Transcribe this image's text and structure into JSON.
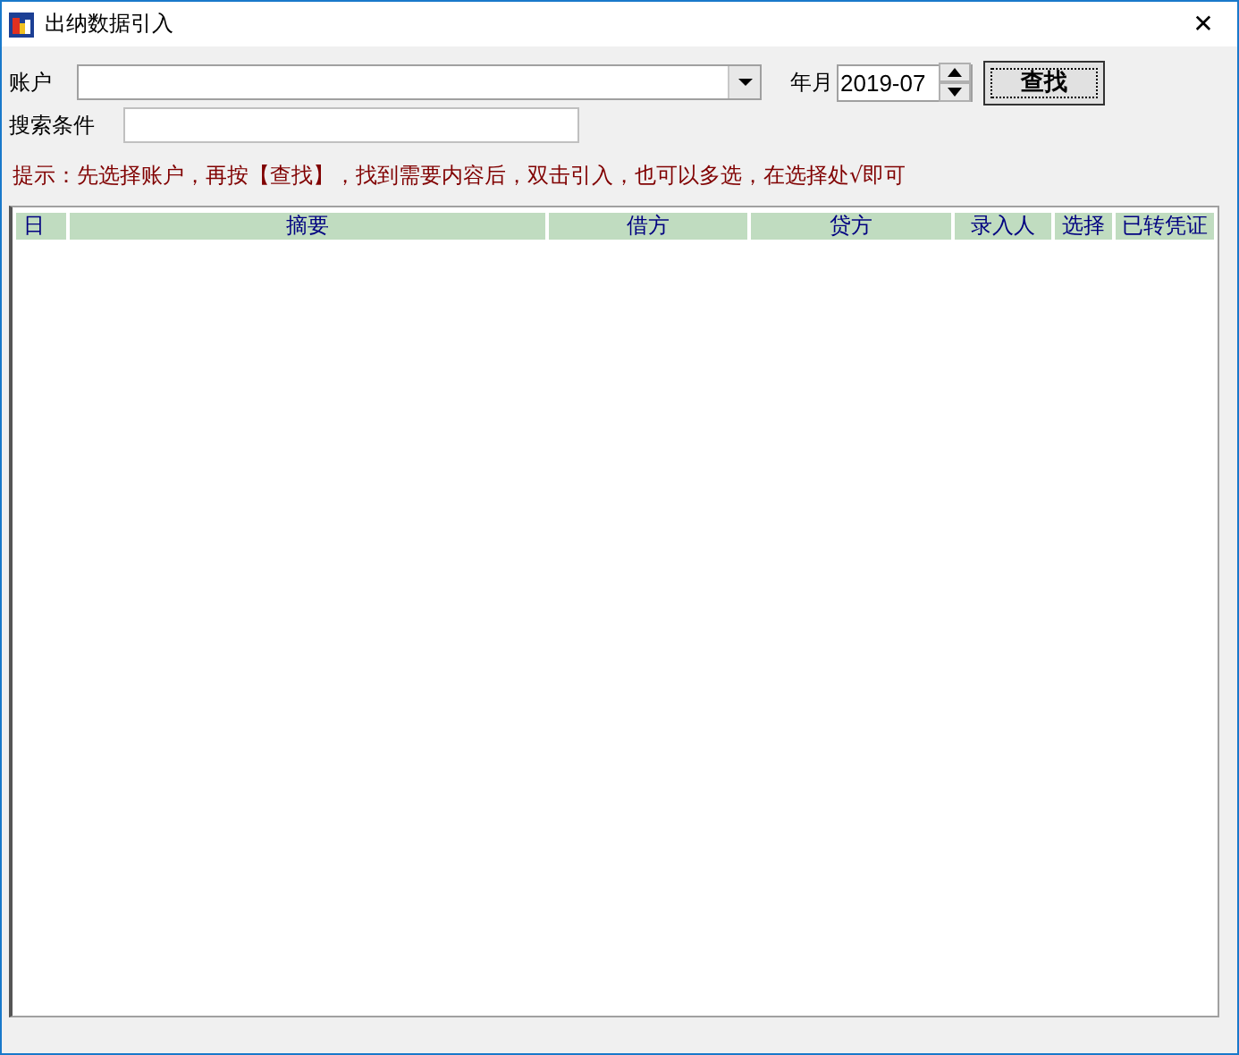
{
  "window": {
    "title": "出纳数据引入",
    "close": "✕"
  },
  "account": {
    "label": "账户"
  },
  "period": {
    "label": "年月",
    "value": "2019-07"
  },
  "find_button": "查找",
  "search": {
    "label": "搜索条件"
  },
  "hint": "提示：先选择账户，再按【查找】，找到需要内容后，双击引入，也可以多选，在选择处√即可",
  "table": {
    "columns": [
      "日",
      "摘要",
      "借方",
      "贷方",
      "录入人",
      "选择",
      "已转凭证"
    ]
  }
}
